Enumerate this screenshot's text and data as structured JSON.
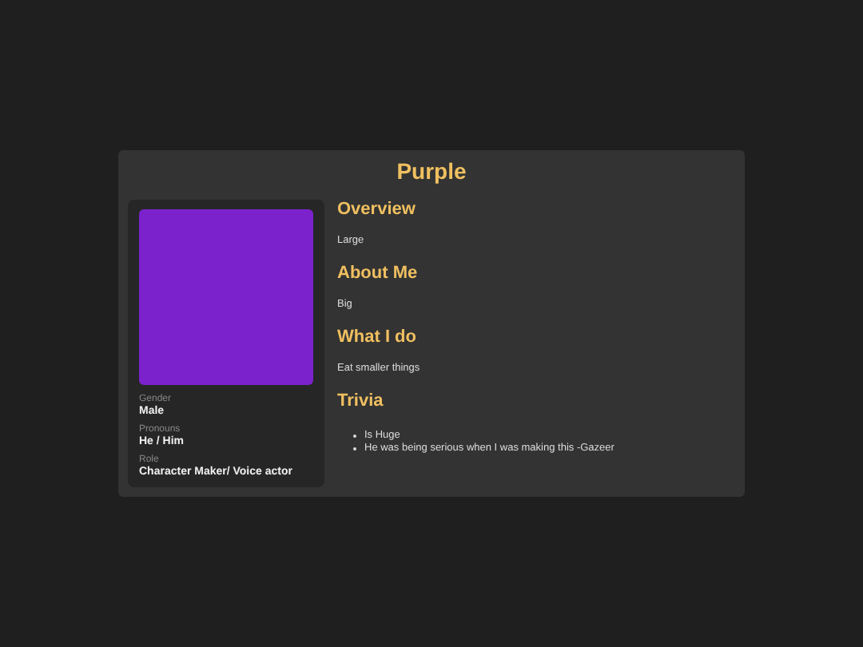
{
  "title": "Purple",
  "profile": {
    "fields": [
      {
        "label": "Gender",
        "value": "Male"
      },
      {
        "label": "Pronouns",
        "value": "He / Him"
      },
      {
        "label": "Role",
        "value": "Character Maker/ Voice actor"
      }
    ]
  },
  "sections": [
    {
      "kind": "text",
      "heading": "Overview",
      "text": "Large"
    },
    {
      "kind": "text",
      "heading": "About Me",
      "text": "Big"
    },
    {
      "kind": "text",
      "heading": "What I do",
      "text": "Eat smaller things"
    },
    {
      "kind": "list",
      "heading": "Trivia",
      "items": [
        "Is Huge",
        "He was being serious when I was making this -Gazeer"
      ]
    }
  ]
}
